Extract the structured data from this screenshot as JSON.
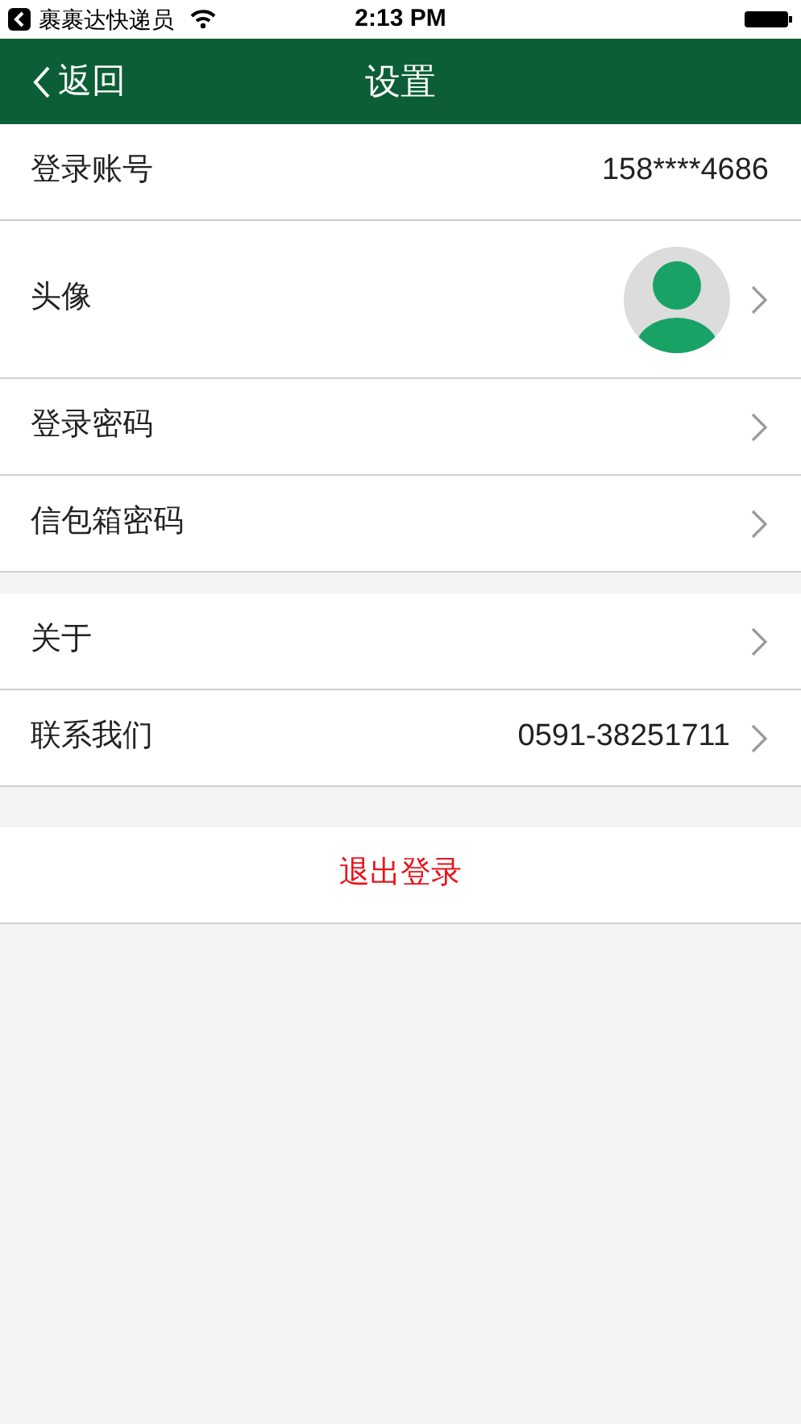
{
  "status_bar": {
    "back_app": "裹裹达快递员",
    "time": "2:13 PM"
  },
  "nav": {
    "back": "返回",
    "title": "设置"
  },
  "sections": [
    {
      "rows": [
        {
          "kind": "value",
          "label": "登录账号",
          "value": "158****4686",
          "arrow": false
        },
        {
          "kind": "avatar",
          "label": "头像",
          "arrow": true
        },
        {
          "kind": "link",
          "label": "登录密码",
          "arrow": true
        },
        {
          "kind": "link",
          "label": "信包箱密码",
          "arrow": true
        }
      ]
    },
    {
      "rows": [
        {
          "kind": "link",
          "label": "关于",
          "arrow": true
        },
        {
          "kind": "value",
          "label": "联系我们",
          "value": "0591-38251711",
          "arrow": true
        }
      ]
    }
  ],
  "logout": "退出登录"
}
